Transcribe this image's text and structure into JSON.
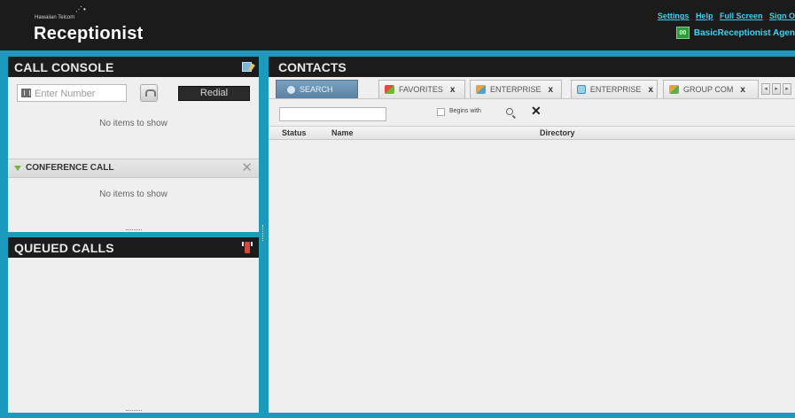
{
  "header": {
    "company": "Hawaiian Telcom",
    "app_title": "Receptionist",
    "links": [
      "Settings",
      "Help",
      "Full Screen",
      "Sign O"
    ],
    "agent_icon_text": "00",
    "agent_name": "BasicReceptionist Agen"
  },
  "call_console": {
    "title": "CALL CONSOLE",
    "number_placeholder": "Enter Number",
    "redial_label": "Redial",
    "empty_text": "No items to show",
    "conference": {
      "label": "CONFERENCE CALL",
      "close_glyph": "✕",
      "empty_text": "No items to show"
    }
  },
  "queued_calls": {
    "title": "QUEUED CALLS"
  },
  "contacts": {
    "title": "CONTACTS",
    "tabs": [
      {
        "label": "SEARCH",
        "closable": false,
        "active": true,
        "icon": "search-icon"
      },
      {
        "label": "FAVORITES",
        "closable": true,
        "active": false,
        "icon": "favorites-icon"
      },
      {
        "label": "ENTERPRISE",
        "closable": true,
        "active": false,
        "icon": "enterprise-icon"
      },
      {
        "label": "ENTERPRISE",
        "closable": true,
        "active": false,
        "icon": "enterprise-common-icon"
      },
      {
        "label": "GROUP COM",
        "closable": true,
        "active": false,
        "icon": "group-common-icon"
      }
    ],
    "tab_close_glyph": "x",
    "nav": {
      "prev": "◂",
      "next": "▸",
      "more": "▸"
    },
    "search": {
      "value": "",
      "begins_with_label": "Begins with",
      "clear_glyph": "✕"
    },
    "columns": [
      "Status",
      "Name",
      "Directory"
    ]
  },
  "colors": {
    "frame": "#1a9bbd",
    "header_bg": "#1b1b1b",
    "link": "#3fd0ee",
    "active_tab": "#5b82a3"
  }
}
